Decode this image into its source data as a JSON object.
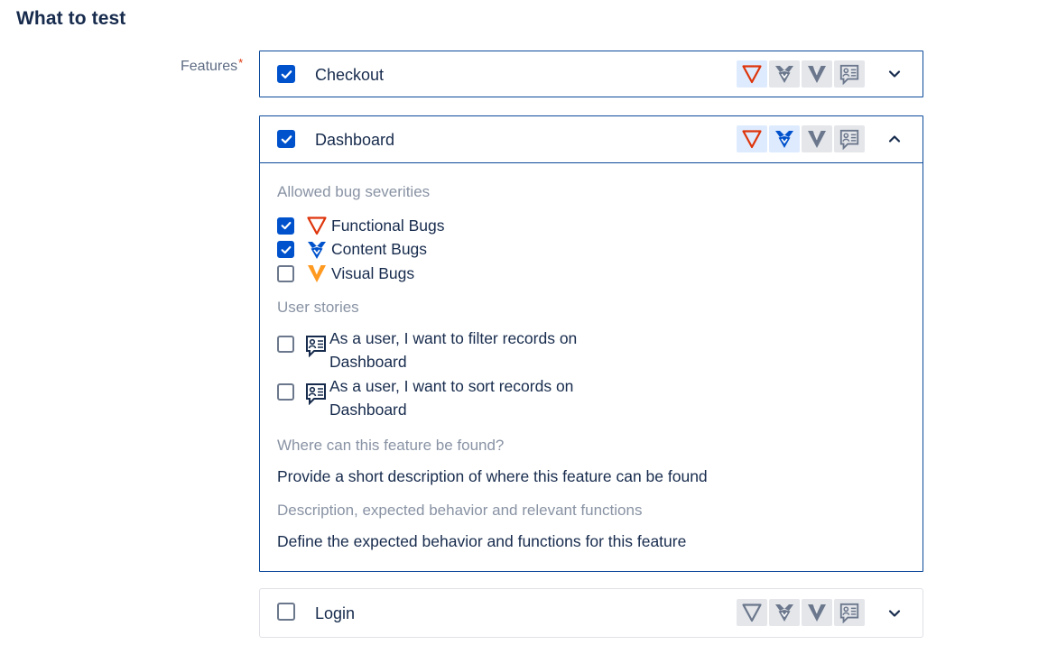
{
  "section": {
    "title": "What to test"
  },
  "features_label": "Features",
  "required_mark": "*",
  "severity_icons": [
    "functional-bug-icon",
    "content-bug-icon",
    "visual-bug-icon",
    "user-story-icon"
  ],
  "colors": {
    "accent": "#0052cc",
    "functional": "#de350b",
    "content": "#0052cc",
    "visual": "#ff991f",
    "muted": "#6b778c"
  },
  "features": [
    {
      "name": "Checkout",
      "checked": true,
      "expanded": false
    },
    {
      "name": "Dashboard",
      "checked": true,
      "expanded": true
    },
    {
      "name": "Login",
      "checked": false,
      "expanded": false
    }
  ],
  "dashboard": {
    "severities_label": "Allowed bug severities",
    "severities": [
      {
        "label": "Functional Bugs",
        "checked": true
      },
      {
        "label": "Content Bugs",
        "checked": true
      },
      {
        "label": "Visual Bugs",
        "checked": false
      }
    ],
    "stories_label": "User stories",
    "stories": [
      {
        "line1": "As a user, I want to filter records on",
        "line2": "Dashboard",
        "checked": false
      },
      {
        "line1": "As a user, I want to sort records on",
        "line2": "Dashboard",
        "checked": false
      }
    ],
    "location_label": "Where can this feature be found?",
    "location_value": "Provide a short description of where this feature can be found",
    "description_label": "Description, expected behavior and relevant functions",
    "description_value": "Define the expected behavior and functions for this feature"
  }
}
